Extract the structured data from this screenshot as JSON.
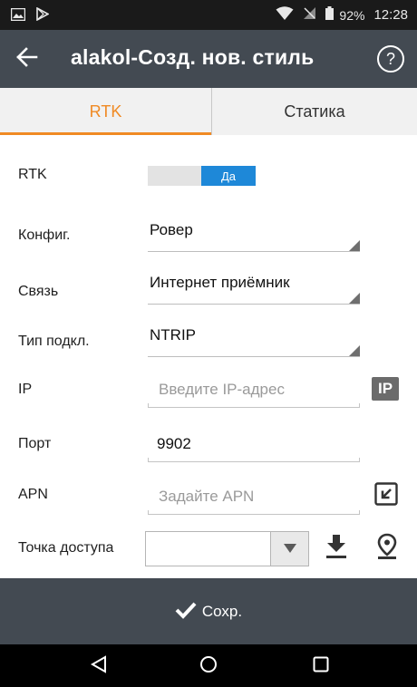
{
  "status_bar": {
    "battery": "92%",
    "time": "12:28"
  },
  "header": {
    "title": "alakol-Созд. нов. стиль",
    "help_label": "?"
  },
  "tabs": [
    {
      "label": "RTK",
      "active": true
    },
    {
      "label": "Статика",
      "active": false
    }
  ],
  "form": {
    "rtk": {
      "label": "RTK",
      "toggle_value": "Да"
    },
    "config": {
      "label": "Конфиг.",
      "value": "Ровер"
    },
    "link": {
      "label": "Связь",
      "value": "Интернет приёмник"
    },
    "conn_type": {
      "label": "Тип подкл.",
      "value": "NTRIP"
    },
    "ip": {
      "label": "IP",
      "placeholder": "Введите IP-адрес",
      "button_label": "IP"
    },
    "port": {
      "label": "Порт",
      "value": "9902"
    },
    "apn": {
      "label": "APN",
      "placeholder": "Задайте APN"
    },
    "access_point": {
      "label": "Точка доступа",
      "value": ""
    }
  },
  "save_bar": {
    "label": "Сохр."
  },
  "colors": {
    "accent": "#f08a24",
    "toggle_on": "#1e88d8",
    "header_bg": "#434a52"
  }
}
